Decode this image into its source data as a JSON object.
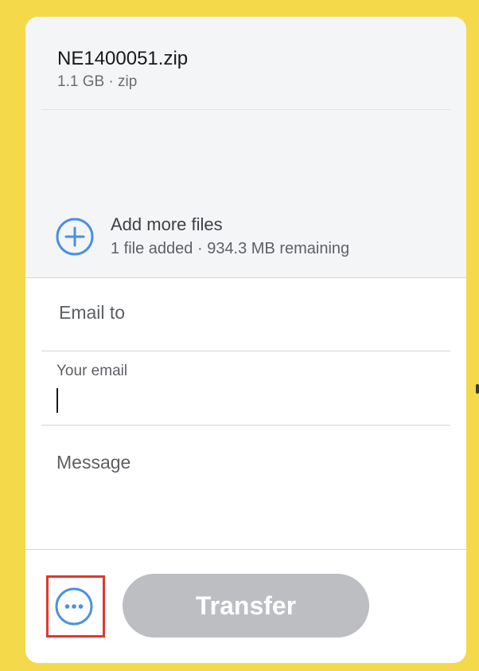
{
  "file": {
    "name": "NE1400051.zip",
    "meta": "1.1 GB · zip"
  },
  "add_files": {
    "icon": "plus-circle-icon",
    "title": "Add more files",
    "subtitle": "1 file added · 934.3 MB remaining"
  },
  "form": {
    "email_to_placeholder": "Email to",
    "your_email_label": "Your email",
    "message_placeholder": "Message"
  },
  "actions": {
    "more_icon": "more-options-icon",
    "transfer_label": "Transfer"
  },
  "colors": {
    "accent": "#4a90e2",
    "background": "#f4d94a",
    "button_disabled": "#bcbec2",
    "highlight": "#e0372f"
  }
}
